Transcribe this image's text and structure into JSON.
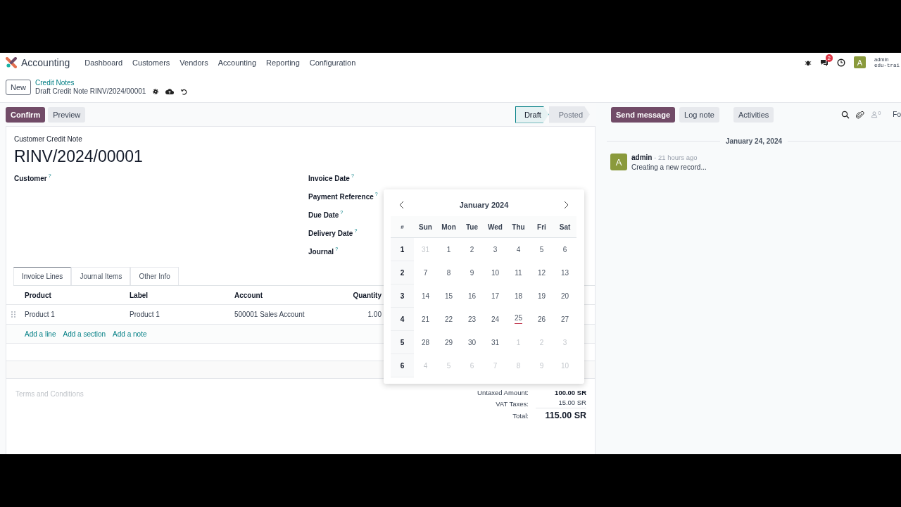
{
  "navbar": {
    "app": "Accounting",
    "menu": [
      "Dashboard",
      "Customers",
      "Vendors",
      "Accounting",
      "Reporting",
      "Configuration"
    ],
    "chat_badge": "2",
    "avatar": "A",
    "user": "admin",
    "database": "edu-trai"
  },
  "control_panel": {
    "new_button": "New",
    "breadcrumb": "Credit Notes",
    "record": "Draft Credit Note RINV/2024/00001"
  },
  "actions": [
    {
      "label": "Confirm",
      "kind": "primary"
    },
    {
      "label": "Preview",
      "kind": "secondary"
    }
  ],
  "status_steps": [
    {
      "label": "Draft",
      "selected": true
    },
    {
      "label": "Posted",
      "selected": false
    }
  ],
  "form": {
    "type": "Customer Credit Note",
    "name": "RINV/2024/00001",
    "left_fields": [
      {
        "label": "Customer",
        "help": "?"
      }
    ],
    "right_fields": [
      {
        "label": "Invoice Date",
        "help": "?"
      },
      {
        "label": "Payment Reference",
        "help": "?"
      },
      {
        "label": "Due Date",
        "help": "?"
      },
      {
        "label": "Delivery Date",
        "help": "?"
      },
      {
        "label": "Journal",
        "help": "?"
      }
    ],
    "tabs": [
      {
        "label": "Invoice Lines",
        "selected": true
      },
      {
        "label": "Journal Items",
        "selected": false
      },
      {
        "label": "Other Info",
        "selected": false
      }
    ],
    "table": {
      "columns": [
        "Product",
        "Label",
        "Account",
        "Quantity"
      ],
      "rows": [
        {
          "cells": [
            "Product 1",
            "Product 1",
            "500001 Sales Account",
            "1.00"
          ]
        }
      ]
    },
    "add_links": [
      "Add a line",
      "Add a section",
      "Add a note"
    ],
    "terms_placeholder": "Terms and Conditions",
    "totals": [
      {
        "label": "Untaxed Amount:",
        "value": "100.00 SR",
        "kind": "bold"
      },
      {
        "label": "VAT Taxes:",
        "value": "15.00 SR",
        "kind": "normal"
      },
      {
        "label": "Total:",
        "value": "115.00 SR",
        "kind": "grand"
      }
    ]
  },
  "datepicker": {
    "title": "January 2024",
    "week_header": "#",
    "weekdays": [
      "Sun",
      "Mon",
      "Tue",
      "Wed",
      "Thu",
      "Fri",
      "Sat"
    ],
    "weeks": [
      {
        "number": "1",
        "days": [
          {
            "label": "31",
            "muted": true,
            "today": false
          },
          {
            "label": "1",
            "muted": false,
            "today": false
          },
          {
            "label": "2",
            "muted": false,
            "today": false
          },
          {
            "label": "3",
            "muted": false,
            "today": false
          },
          {
            "label": "4",
            "muted": false,
            "today": false
          },
          {
            "label": "5",
            "muted": false,
            "today": false
          },
          {
            "label": "6",
            "muted": false,
            "today": false
          }
        ]
      },
      {
        "number": "2",
        "days": [
          {
            "label": "7",
            "muted": false,
            "today": false
          },
          {
            "label": "8",
            "muted": false,
            "today": false
          },
          {
            "label": "9",
            "muted": false,
            "today": false
          },
          {
            "label": "10",
            "muted": false,
            "today": false
          },
          {
            "label": "11",
            "muted": false,
            "today": false
          },
          {
            "label": "12",
            "muted": false,
            "today": false
          },
          {
            "label": "13",
            "muted": false,
            "today": false
          }
        ]
      },
      {
        "number": "3",
        "days": [
          {
            "label": "14",
            "muted": false,
            "today": false
          },
          {
            "label": "15",
            "muted": false,
            "today": false
          },
          {
            "label": "16",
            "muted": false,
            "today": false
          },
          {
            "label": "17",
            "muted": false,
            "today": false
          },
          {
            "label": "18",
            "muted": false,
            "today": false
          },
          {
            "label": "19",
            "muted": false,
            "today": false
          },
          {
            "label": "20",
            "muted": false,
            "today": false
          }
        ]
      },
      {
        "number": "4",
        "days": [
          {
            "label": "21",
            "muted": false,
            "today": false
          },
          {
            "label": "22",
            "muted": false,
            "today": false
          },
          {
            "label": "23",
            "muted": false,
            "today": false
          },
          {
            "label": "24",
            "muted": false,
            "today": false
          },
          {
            "label": "25",
            "muted": false,
            "today": true
          },
          {
            "label": "26",
            "muted": false,
            "today": false
          },
          {
            "label": "27",
            "muted": false,
            "today": false
          }
        ]
      },
      {
        "number": "5",
        "days": [
          {
            "label": "28",
            "muted": false,
            "today": false
          },
          {
            "label": "29",
            "muted": false,
            "today": false
          },
          {
            "label": "30",
            "muted": false,
            "today": false
          },
          {
            "label": "31",
            "muted": false,
            "today": false
          },
          {
            "label": "1",
            "muted": true,
            "today": false
          },
          {
            "label": "2",
            "muted": true,
            "today": false
          },
          {
            "label": "3",
            "muted": true,
            "today": false
          }
        ]
      },
      {
        "number": "6",
        "days": [
          {
            "label": "4",
            "muted": true,
            "today": false
          },
          {
            "label": "5",
            "muted": true,
            "today": false
          },
          {
            "label": "6",
            "muted": true,
            "today": false
          },
          {
            "label": "7",
            "muted": true,
            "today": false
          },
          {
            "label": "8",
            "muted": true,
            "today": false
          },
          {
            "label": "9",
            "muted": true,
            "today": false
          },
          {
            "label": "10",
            "muted": true,
            "today": false
          }
        ]
      }
    ]
  },
  "chatter": {
    "buttons": [
      {
        "label": "Send message",
        "kind": "primary"
      },
      {
        "label": "Log note",
        "kind": "secondary"
      },
      {
        "label": "Activities",
        "kind": "secondary"
      }
    ],
    "follower_count": "0",
    "follow": "Fo",
    "date": "January 24, 2024",
    "messages": [
      {
        "avatar": "A",
        "author": "admin",
        "time": "- 21 hours ago",
        "body": "Creating a new record..."
      }
    ]
  }
}
